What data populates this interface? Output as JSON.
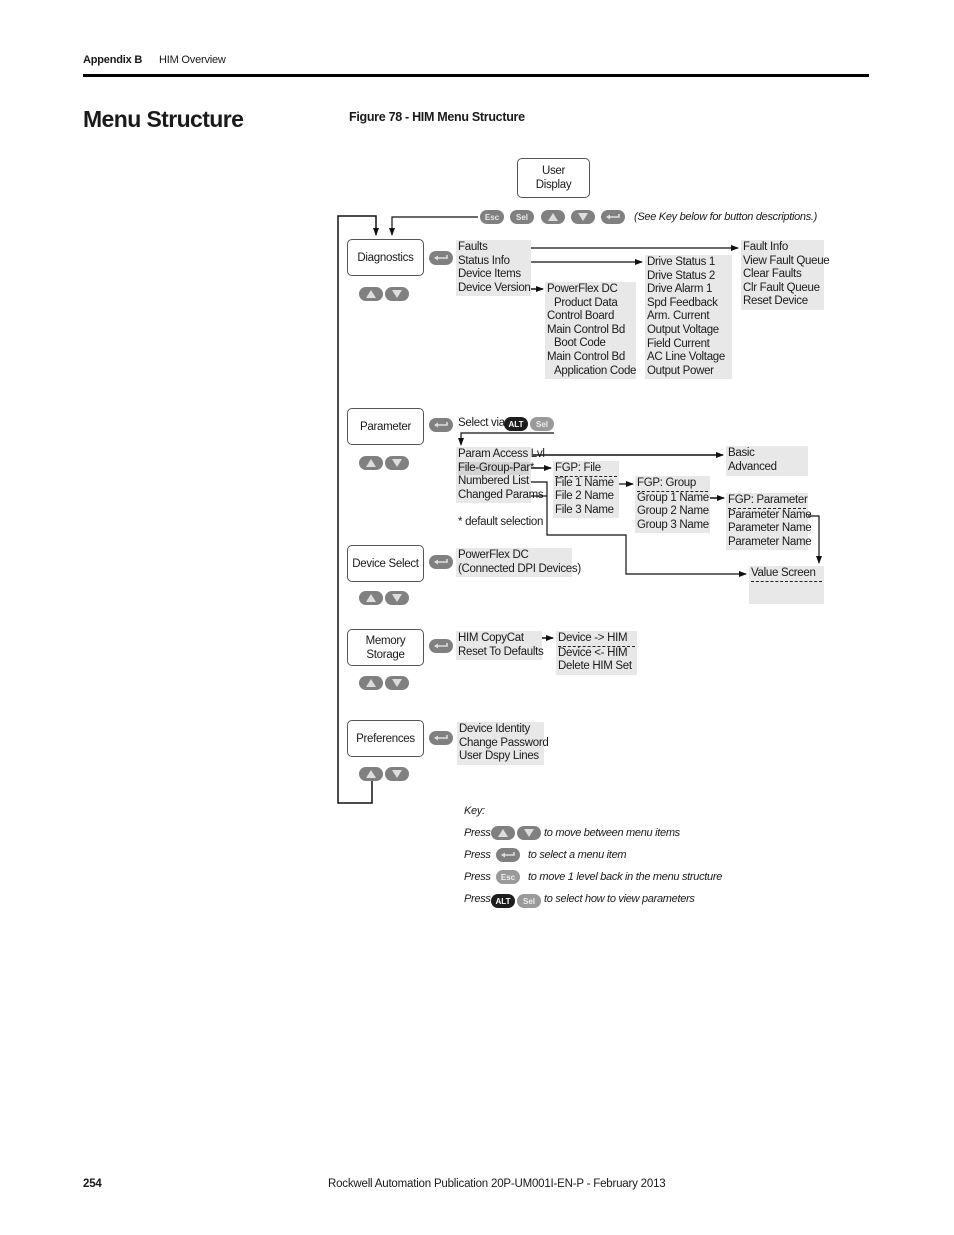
{
  "header": {
    "section": "Appendix B",
    "title": "HIM Overview"
  },
  "heading": "Menu Structure",
  "figure": {
    "caption": "Figure 78 - HIM Menu Structure",
    "user_display": [
      "User",
      "Display"
    ],
    "button_hint": "(See Key below for button descriptions.)",
    "buttons": {
      "esc": "Esc",
      "sel": "Sel",
      "alt": "ALT"
    },
    "menus": [
      {
        "label": "Diagnostics"
      },
      {
        "label": "Parameter"
      },
      {
        "label": "Device Select"
      },
      {
        "label": "Memory Storage"
      },
      {
        "label": "Preferences"
      }
    ],
    "diagnostics": {
      "items": [
        "Faults",
        "Status Info",
        "Device Items",
        "Device Version"
      ],
      "fault_submenu": [
        "Fault Info",
        "View Fault Queue",
        "Clear Faults",
        "Clr Fault Queue",
        "Reset Device"
      ],
      "status_submenu": [
        "Drive Status 1",
        "Drive Status 2",
        "Drive Alarm 1",
        "Spd Feedback",
        "Arm. Current",
        "Output Voltage",
        "Field Current",
        "AC Line Voltage",
        "Output Power"
      ],
      "version_submenu": [
        "PowerFlex DC",
        "Product Data",
        "Control Board",
        "Main Control Bd",
        "Boot Code",
        "Main Control Bd",
        "Application Code"
      ]
    },
    "parameter": {
      "select_via": "Select via",
      "items": [
        "Param Access Lvl",
        "File-Group-Par*",
        "Numbered List",
        "Changed Params"
      ],
      "note": "* default selection",
      "access_submenu": [
        "Basic",
        "Advanced"
      ],
      "file_submenu": [
        "FGP: File",
        "File 1 Name",
        "File 2 Name",
        "File 3 Name"
      ],
      "group_submenu": [
        "FGP: Group",
        "Group 1 Name",
        "Group 2 Name",
        "Group 3 Name"
      ],
      "param_submenu": [
        "FGP: Parameter",
        "Parameter Name",
        "Parameter Name",
        "Parameter Name"
      ],
      "value_screen": "Value Screen"
    },
    "device_select": {
      "items": [
        "PowerFlex DC",
        "(Connected DPI Devices)"
      ]
    },
    "memory_storage": {
      "items": [
        "HIM CopyCat",
        "Reset To Defaults"
      ],
      "copycat_submenu": [
        "Device -> HIM",
        "Device <- HIM",
        "Delete HIM Set"
      ]
    },
    "preferences": {
      "items": [
        "Device Identity",
        "Change Password",
        "User Dspy Lines"
      ]
    },
    "key": {
      "title": "Key:",
      "rows": [
        {
          "press": "Press",
          "text": "to move between menu items"
        },
        {
          "press": "Press",
          "text": "to select a menu item"
        },
        {
          "press": "Press",
          "text": "to move 1 level back in the menu structure"
        },
        {
          "press": "Press",
          "text": "to select how to view parameters"
        }
      ]
    }
  },
  "footer": {
    "page": "254",
    "publication": "Rockwell Automation Publication 20P-UM001I-EN-P - February 2013"
  }
}
